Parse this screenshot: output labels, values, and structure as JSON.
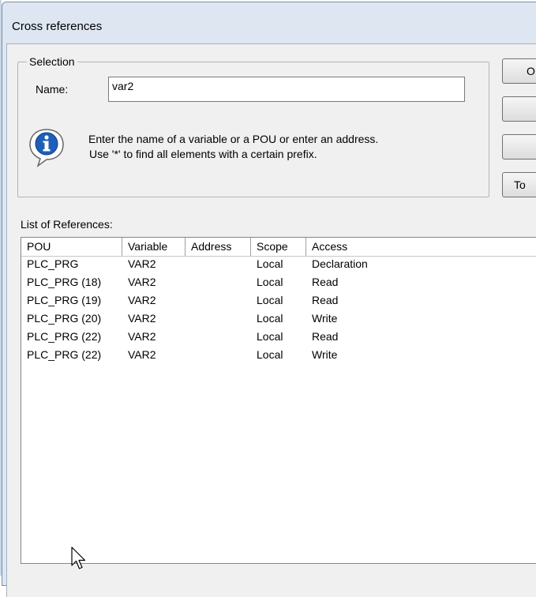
{
  "window": {
    "title": "Cross references"
  },
  "selection": {
    "legend": "Selection",
    "name_label": "Name:",
    "name_value": "var2",
    "info_line1": "Enter the name of a variable or a POU or enter an address.",
    "info_line2": "Use '*' to find all elements with a certain prefix."
  },
  "buttons": {
    "b1": "O",
    "b2": "",
    "b3": "",
    "b4": "To"
  },
  "list": {
    "label": "List of References:",
    "columns": [
      "POU",
      "Variable",
      "Address",
      "Scope",
      "Access"
    ],
    "rows": [
      {
        "pou": "PLC_PRG",
        "variable": "VAR2",
        "address": "",
        "scope": "Local",
        "access": "Declaration"
      },
      {
        "pou": "PLC_PRG (18)",
        "variable": "VAR2",
        "address": "",
        "scope": "Local",
        "access": "Read"
      },
      {
        "pou": "PLC_PRG (19)",
        "variable": "VAR2",
        "address": "",
        "scope": "Local",
        "access": "Read"
      },
      {
        "pou": "PLC_PRG (20)",
        "variable": "VAR2",
        "address": "",
        "scope": "Local",
        "access": "Write"
      },
      {
        "pou": "PLC_PRG (22)",
        "variable": "VAR2",
        "address": "",
        "scope": "Local",
        "access": "Read"
      },
      {
        "pou": "PLC_PRG (22)",
        "variable": "VAR2",
        "address": "",
        "scope": "Local",
        "access": "Write"
      }
    ]
  },
  "icons": {
    "info": "info-icon",
    "cursor": "mouse-pointer-icon"
  },
  "colors": {
    "window_frame": "#dde6f1",
    "client_bg": "#f0f0f0",
    "info_blue": "#1f5fb8"
  }
}
